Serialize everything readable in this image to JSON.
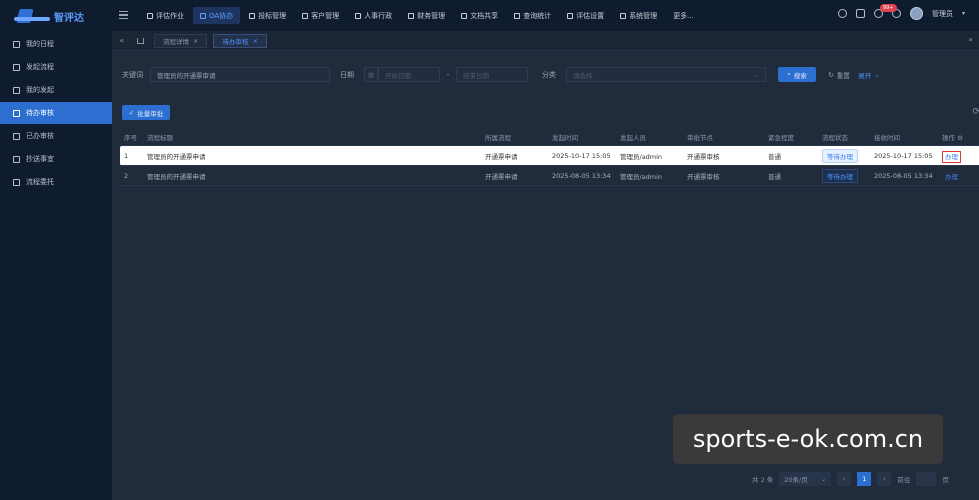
{
  "app": {
    "name": "智评达"
  },
  "topnav": [
    {
      "label": "评估作业",
      "active": false
    },
    {
      "label": "OA协办",
      "active": true
    },
    {
      "label": "投标管理",
      "active": false
    },
    {
      "label": "客户管理",
      "active": false
    },
    {
      "label": "人事行政",
      "active": false
    },
    {
      "label": "财务管理",
      "active": false
    },
    {
      "label": "文档共享",
      "active": false
    },
    {
      "label": "查询统计",
      "active": false
    },
    {
      "label": "评估设置",
      "active": false
    },
    {
      "label": "系统管理",
      "active": false
    },
    {
      "label": "更多...",
      "active": false
    }
  ],
  "header_right": {
    "badge": "99+",
    "user": "管理员"
  },
  "sidebar": [
    {
      "label": "我的日程",
      "active": false
    },
    {
      "label": "发起流程",
      "active": false
    },
    {
      "label": "我的发起",
      "active": false
    },
    {
      "label": "待办审核",
      "active": true
    },
    {
      "label": "已办审核",
      "active": false
    },
    {
      "label": "抄送事宜",
      "active": false
    },
    {
      "label": "流程委托",
      "active": false
    }
  ],
  "tabs": [
    {
      "label": "流程详情",
      "active": false
    },
    {
      "label": "待办审核",
      "active": true
    }
  ],
  "filter": {
    "keyword_label": "关键词",
    "keyword_value": "管理员的开通票审请",
    "date_label": "日期",
    "date_start_ph": "开始日期",
    "date_sep": "-",
    "date_end_ph": "结束日期",
    "category_label": "分类",
    "category_ph": "请选择",
    "search_btn": "搜索",
    "reset_btn": "重置",
    "expand_btn": "展开"
  },
  "toolbar": {
    "batch_btn": "批量审批"
  },
  "table": {
    "headers": [
      "序号",
      "流程标题",
      "所属流程",
      "发起时间",
      "发起人员",
      "审批节点",
      "紧急程度",
      "流程状态",
      "接收时间",
      "操作"
    ],
    "rows": [
      {
        "no": "1",
        "title": "管理员的开通票申请",
        "flow": "开通票申请",
        "start": "2025-10-17 15:05",
        "initiator": "管理员/admin",
        "node": "开通票审核",
        "urgency": "普通",
        "status": "等待办理",
        "received": "2025-10-17 15:05",
        "action": "办理"
      },
      {
        "no": "2",
        "title": "管理员的开通票申请",
        "flow": "开通票申请",
        "start": "2025-08-05 13:34",
        "initiator": "管理员/admin",
        "node": "开通票审核",
        "urgency": "普通",
        "status": "等待办理",
        "received": "2025-08-05 13:34",
        "action": "办理"
      }
    ]
  },
  "pager": {
    "total": "共 2 条",
    "size": "20条/页",
    "page": "1",
    "goto": "前往",
    "page_unit": "页"
  },
  "watermark": "sports-e-ok.com.cn",
  "colors": {
    "accent": "#2d6fd1",
    "link": "#3c7ff0",
    "alert": "#e23a3a"
  }
}
